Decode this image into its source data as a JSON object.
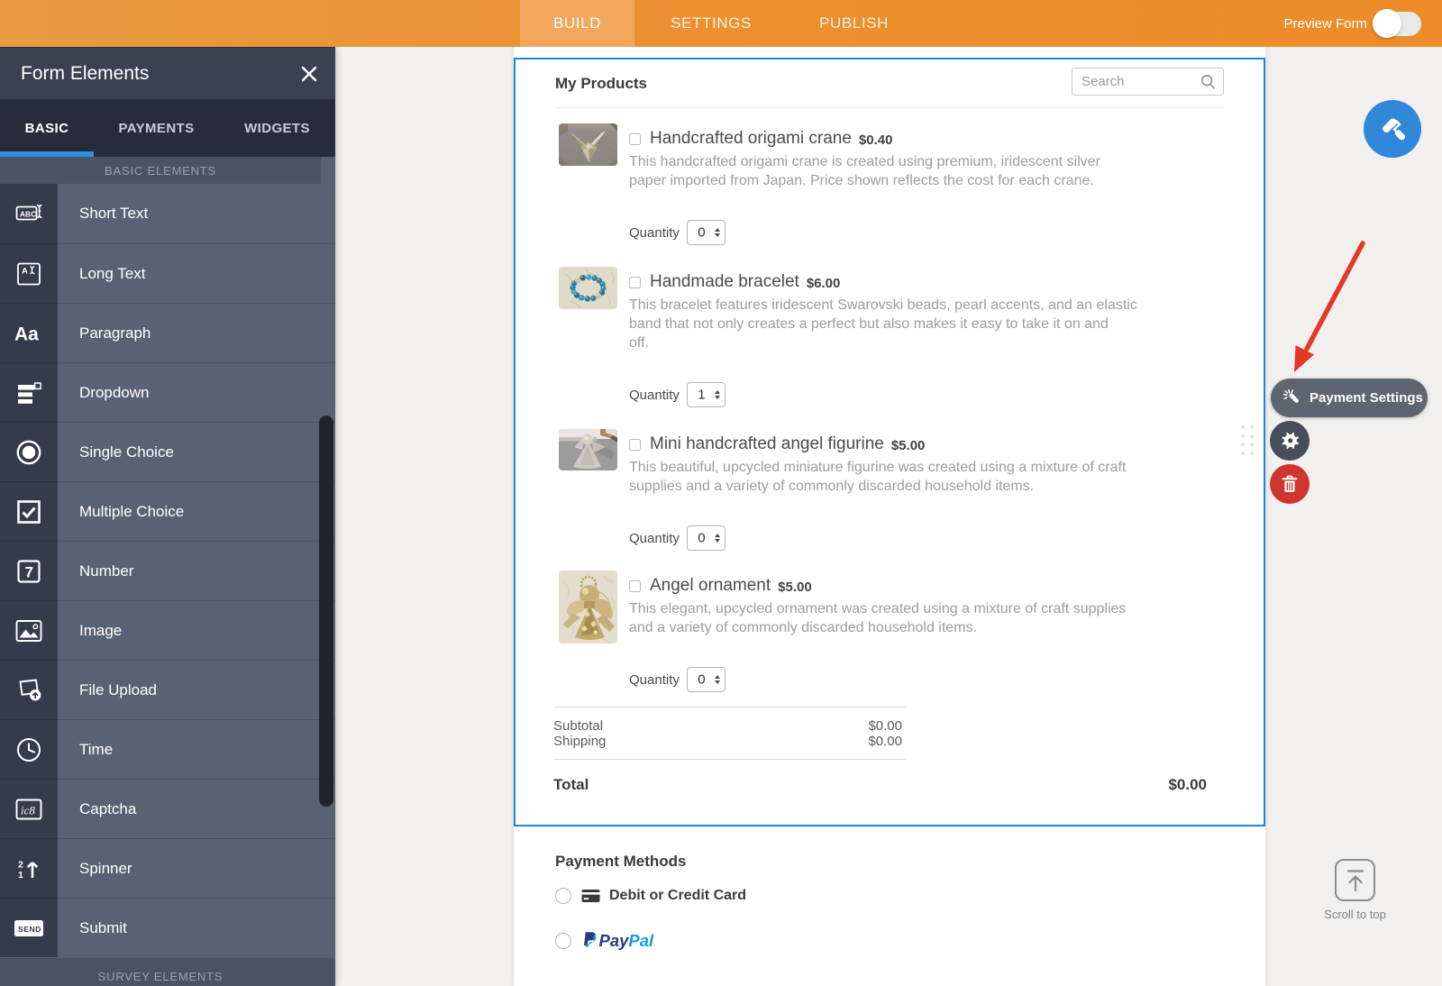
{
  "header": {
    "tabs": [
      {
        "id": "build",
        "label": "BUILD",
        "active": true
      },
      {
        "id": "settings",
        "label": "SETTINGS",
        "active": false
      },
      {
        "id": "publish",
        "label": "PUBLISH",
        "active": false
      }
    ],
    "preview_label": "Preview Form",
    "preview_toggle_on": false
  },
  "sidebar": {
    "title": "Form Elements",
    "tabs": [
      {
        "label": "BASIC",
        "active": true
      },
      {
        "label": "PAYMENTS",
        "active": false
      },
      {
        "label": "WIDGETS",
        "active": false
      }
    ],
    "section_header": "BASIC ELEMENTS",
    "items": [
      {
        "label": "Short Text",
        "icon": "short-text"
      },
      {
        "label": "Long Text",
        "icon": "long-text"
      },
      {
        "label": "Paragraph",
        "icon": "paragraph"
      },
      {
        "label": "Dropdown",
        "icon": "dropdown"
      },
      {
        "label": "Single Choice",
        "icon": "single-choice"
      },
      {
        "label": "Multiple Choice",
        "icon": "multiple-choice"
      },
      {
        "label": "Number",
        "icon": "number"
      },
      {
        "label": "Image",
        "icon": "image"
      },
      {
        "label": "File Upload",
        "icon": "file-upload"
      },
      {
        "label": "Time",
        "icon": "time"
      },
      {
        "label": "Captcha",
        "icon": "captcha"
      },
      {
        "label": "Spinner",
        "icon": "spinner"
      },
      {
        "label": "Submit",
        "icon": "submit"
      }
    ],
    "footer_section": "SURVEY ELEMENTS"
  },
  "form": {
    "title": "My Products",
    "search_placeholder": "Search",
    "quantity_label": "Quantity",
    "products": [
      {
        "name": "Handcrafted origami crane",
        "price": "$0.40",
        "description": "This handcrafted origami crane is created using premium, iridescent silver\npaper imported from Japan. Price shown reflects the cost for each crane.",
        "quantity": "0",
        "checked": false,
        "image": "origami-crane"
      },
      {
        "name": "Handmade bracelet",
        "price": "$6.00",
        "description": "This bracelet features iridescent Swarovski beads, pearl accents, and an elastic\nband that not only creates a perfect but also makes it easy to take it on and\noff.",
        "quantity": "1",
        "checked": false,
        "image": "bracelet"
      },
      {
        "name": "Mini handcrafted angel figurine",
        "price": "$5.00",
        "description": "This beautiful, upcycled miniature figurine was created using a mixture of craft\nsupplies and a variety of commonly discarded household items.",
        "quantity": "0",
        "checked": false,
        "image": "angel-figurine"
      },
      {
        "name": "Angel ornament",
        "price": "$5.00",
        "description": "This elegant, upcycled ornament was created using a mixture of craft supplies\nand a variety of commonly discarded household items.",
        "quantity": "0",
        "checked": false,
        "image": "angel-ornament"
      }
    ],
    "summary": {
      "subtotal_label": "Subtotal",
      "subtotal_value": "$0.00",
      "shipping_label": "Shipping",
      "shipping_value": "$0.00",
      "total_label": "Total",
      "total_value": "$0.00"
    }
  },
  "payment_methods": {
    "title": "Payment Methods",
    "options": [
      {
        "label": "Debit or Credit Card",
        "icon": "credit-card",
        "selected": false
      },
      {
        "label": "PayPal",
        "icon": "paypal",
        "selected": false
      }
    ]
  },
  "floating": {
    "payment_settings_label": "Payment Settings",
    "scroll_top_label": "Scroll to top"
  },
  "colors": {
    "topbar_orange": "#ed8c29",
    "active_tab_orange": "#f1a85d",
    "sidebar_dark": "#3a4150",
    "sidebar_row": "#596274",
    "accent_blue": "#2f90e0",
    "selection_blue": "#1d86da",
    "roller_blue": "#3187d8",
    "pill_gray": "#5d6570",
    "gear_gray": "#474e59",
    "trash_red": "#ce352c",
    "arrow_red": "#e23a26",
    "paypal_navy": "#253b80",
    "paypal_blue": "#179bd7"
  }
}
